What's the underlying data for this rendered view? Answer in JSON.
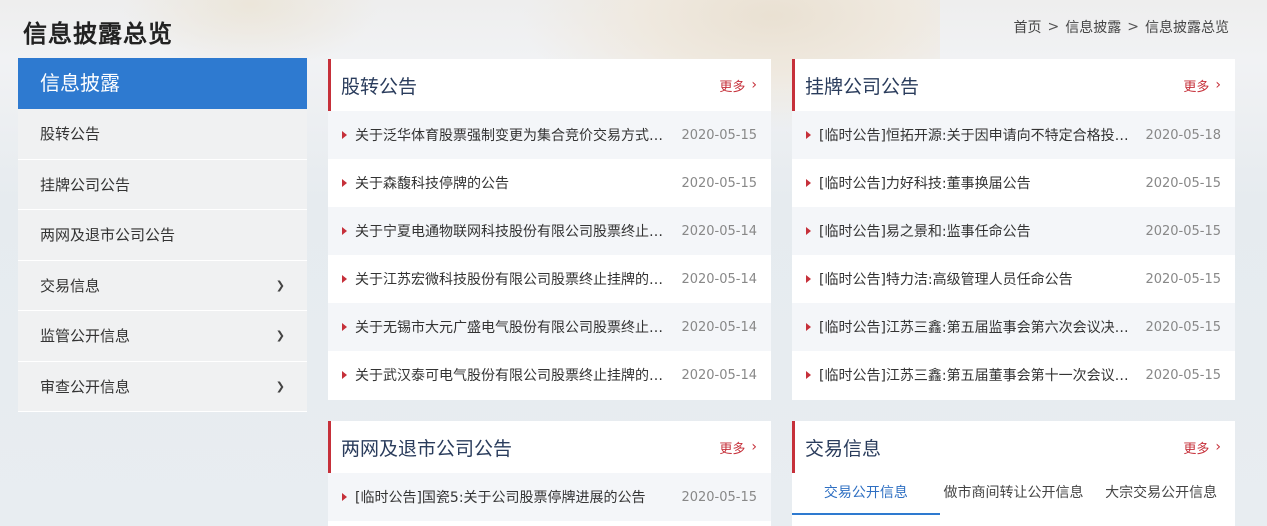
{
  "header": {
    "title": "信息披露总览",
    "breadcrumb": [
      "首页",
      "信息披露",
      "信息披露总览"
    ],
    "sep": ">"
  },
  "sidebar": {
    "title": "信息披露",
    "items": [
      {
        "label": "股转公告",
        "has_children": false
      },
      {
        "label": "挂牌公司公告",
        "has_children": false
      },
      {
        "label": "两网及退市公司公告",
        "has_children": false
      },
      {
        "label": "交易信息",
        "has_children": true
      },
      {
        "label": "监管公开信息",
        "has_children": true
      },
      {
        "label": "审查公开信息",
        "has_children": true
      }
    ]
  },
  "more_label": "更多",
  "panels": {
    "gzgg": {
      "title": "股转公告",
      "rows": [
        {
          "text": "关于泛华体育股票强制变更为集合竞价交易方式的公告",
          "date": "2020-05-15"
        },
        {
          "text": "关于森馥科技停牌的公告",
          "date": "2020-05-15"
        },
        {
          "text": "关于宁夏电通物联网科技股份有限公司股票终止挂牌的公告",
          "date": "2020-05-14"
        },
        {
          "text": "关于江苏宏微科技股份有限公司股票终止挂牌的公告",
          "date": "2020-05-14"
        },
        {
          "text": "关于无锡市大元广盛电气股份有限公司股票终止挂牌的公告",
          "date": "2020-05-14"
        },
        {
          "text": "关于武汉泰可电气股份有限公司股票终止挂牌的公告",
          "date": "2020-05-14"
        }
      ]
    },
    "gpgsgg": {
      "title": "挂牌公司公告",
      "rows": [
        {
          "text": "[临时公告]恒拓开源:关于因申请向不特定合格投资者公开发行股票",
          "date": "2020-05-18"
        },
        {
          "text": "[临时公告]力好科技:董事换届公告",
          "date": "2020-05-15"
        },
        {
          "text": "[临时公告]易之景和:监事任命公告",
          "date": "2020-05-15"
        },
        {
          "text": "[临时公告]特力洁:高级管理人员任命公告",
          "date": "2020-05-15"
        },
        {
          "text": "[临时公告]江苏三鑫:第五届监事会第六次会议决议公告",
          "date": "2020-05-15"
        },
        {
          "text": "[临时公告]江苏三鑫:第五届董事会第十一次会议决议公告",
          "date": "2020-05-15"
        }
      ]
    },
    "lwts": {
      "title": "两网及退市公司公告",
      "rows": [
        {
          "text": "[临时公告]国瓷5:关于公司股票停牌进展的公告",
          "date": "2020-05-15"
        }
      ]
    },
    "jyxx": {
      "title": "交易信息",
      "tabs": [
        "交易公开信息",
        "做市商间转让公开信息",
        "大宗交易公开信息"
      ],
      "active_tab": 0
    }
  },
  "colors": {
    "accent_blue": "#2e7ad0",
    "accent_red": "#c6303a"
  }
}
